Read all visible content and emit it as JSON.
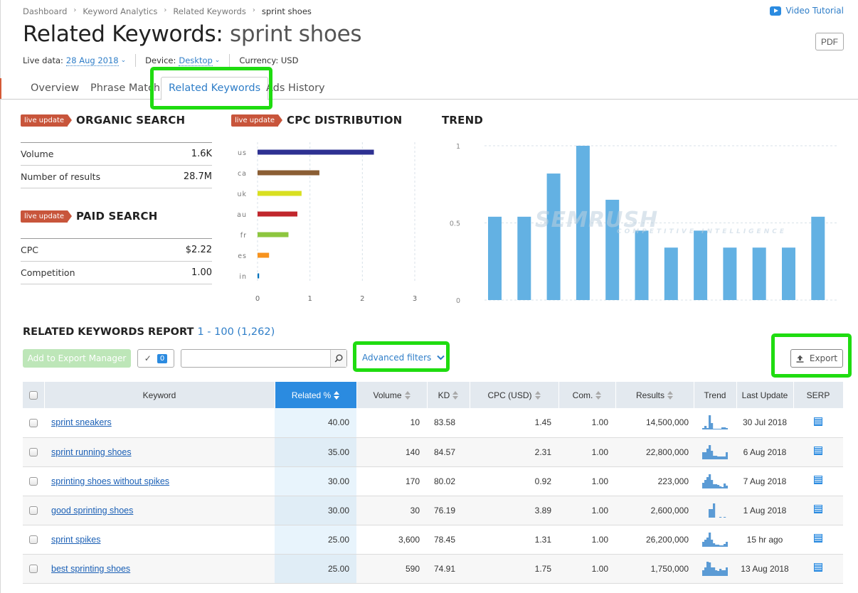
{
  "breadcrumb": [
    "Dashboard",
    "Keyword Analytics",
    "Related Keywords",
    "sprint shoes"
  ],
  "video_tutorial": "Video Tutorial",
  "pdf_label": "PDF",
  "title": {
    "prefix": "Related Keywords:",
    "keyword": "sprint shoes"
  },
  "meta": {
    "live_label": "Live data:",
    "live_value": "28 Aug 2018",
    "device_label": "Device:",
    "device_value": "Desktop",
    "currency": "Currency: USD"
  },
  "tabs": [
    "Overview",
    "Phrase Match",
    "Related Keywords",
    "Ads History"
  ],
  "active_tab": "Related Keywords",
  "live_badge": "live update",
  "organic": {
    "title": "ORGANIC SEARCH",
    "rows": [
      {
        "label": "Volume",
        "value": "1.6K"
      },
      {
        "label": "Number of results",
        "value": "28.7M"
      }
    ]
  },
  "paid": {
    "title": "PAID SEARCH",
    "rows": [
      {
        "label": "CPC",
        "value": "$2.22"
      },
      {
        "label": "Competition",
        "value": "1.00"
      }
    ]
  },
  "chart_data": [
    {
      "type": "bar",
      "orientation": "horizontal",
      "title": "CPC DISTRIBUTION",
      "categories": [
        "us",
        "ca",
        "uk",
        "au",
        "fr",
        "es",
        "in"
      ],
      "values": [
        2.22,
        1.18,
        0.84,
        0.76,
        0.59,
        0.22,
        0.03
      ],
      "colors": [
        "#2e3192",
        "#8b5e34",
        "#d9e021",
        "#c1272d",
        "#8dc63f",
        "#f7931e",
        "#0071bc"
      ],
      "xlim": [
        0,
        3
      ],
      "xticks": [
        "0",
        "1",
        "2",
        "3"
      ],
      "grid": true
    },
    {
      "type": "bar",
      "title": "TREND",
      "values": [
        0.54,
        0.54,
        0.82,
        1.0,
        0.65,
        0.45,
        0.34,
        0.45,
        0.34,
        0.34,
        0.34,
        0.54
      ],
      "color": "#63b1e3",
      "ylim": [
        0,
        1
      ],
      "yticks": [
        "0",
        "0.5",
        "1"
      ],
      "grid": true,
      "watermark": [
        "SEMRUSH",
        "COMPETITIVE INTELLIGENCE"
      ]
    }
  ],
  "report": {
    "title": "RELATED KEYWORDS REPORT",
    "range": "1 - 100 (1,262)",
    "add_export": "Add to Export Manager",
    "selected_count": "0",
    "search_value": "",
    "advanced_filters": "Advanced filters",
    "export": "Export",
    "columns": [
      "Keyword",
      "Related %",
      "Volume",
      "KD",
      "CPC (USD)",
      "Com.",
      "Results",
      "Trend",
      "Last Update",
      "SERP"
    ],
    "sorted_column": "Related %",
    "rows": [
      {
        "keyword": "sprint sneakers",
        "related": "40.00",
        "volume": "10",
        "kd": "83.58",
        "cpc": "1.45",
        "com": "1.00",
        "results": "14,500,000",
        "trend": [
          0.1,
          0.25,
          0.1,
          1.0,
          0.45,
          0.05,
          0.05,
          0.05,
          0.05,
          0.15,
          0.15,
          0.1
        ],
        "updated": "30 Jul 2018"
      },
      {
        "keyword": "sprint running shoes",
        "related": "35.00",
        "volume": "140",
        "kd": "84.57",
        "cpc": "2.31",
        "com": "1.00",
        "results": "22,800,000",
        "trend": [
          0.5,
          0.5,
          0.75,
          1.0,
          0.6,
          0.25,
          0.25,
          0.2,
          0.2,
          0.2,
          0.2,
          0.5
        ],
        "updated": "6 Aug 2018"
      },
      {
        "keyword": "sprinting shoes without spikes",
        "related": "30.00",
        "volume": "170",
        "kd": "80.02",
        "cpc": "0.92",
        "com": "1.00",
        "results": "223,000",
        "trend": [
          0.4,
          0.6,
          0.8,
          1.0,
          0.6,
          0.3,
          0.3,
          0.25,
          0.15,
          0.1,
          0.35,
          0.2
        ],
        "updated": "7 Aug 2018"
      },
      {
        "keyword": "good sprinting shoes",
        "related": "30.00",
        "volume": "30",
        "kd": "76.19",
        "cpc": "3.89",
        "com": "1.00",
        "results": "2,600,000",
        "trend": [
          0,
          0,
          0,
          0.6,
          0.6,
          1.0,
          0,
          0,
          0.05,
          0,
          0.05,
          0
        ],
        "updated": "1 Aug 2018"
      },
      {
        "keyword": "sprint spikes",
        "related": "25.00",
        "volume": "3,600",
        "kd": "78.45",
        "cpc": "1.31",
        "com": "1.00",
        "results": "26,200,000",
        "trend": [
          0.35,
          0.5,
          0.65,
          1.0,
          0.5,
          0.25,
          0.15,
          0.15,
          0.1,
          0.1,
          0.2,
          0.35
        ],
        "updated": "15 hr ago"
      },
      {
        "keyword": "best sprinting shoes",
        "related": "25.00",
        "volume": "590",
        "kd": "74.91",
        "cpc": "1.75",
        "com": "1.00",
        "results": "1,750,000",
        "trend": [
          0.4,
          0.6,
          1.0,
          0.95,
          0.6,
          0.6,
          0.4,
          0.35,
          0.5,
          0.4,
          0.4,
          0.6
        ],
        "updated": "13 Aug 2018"
      }
    ]
  }
}
